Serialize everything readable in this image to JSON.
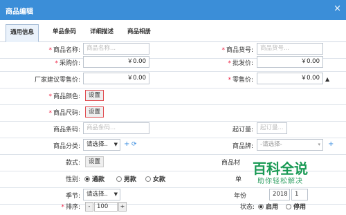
{
  "window": {
    "title": "商品编辑",
    "close_glyph": "×"
  },
  "tabs": [
    {
      "label": "通用信息",
      "active": true
    },
    {
      "label": "单品条码",
      "active": false
    },
    {
      "label": "详细描述",
      "active": false
    },
    {
      "label": "商品相册",
      "active": false
    }
  ],
  "form": {
    "name": {
      "label": "商品名称:",
      "placeholder": "商品名称..."
    },
    "item_no": {
      "label": "商品货号:",
      "placeholder": "商品货号..."
    },
    "purchase_price": {
      "label": "采购价:",
      "value": "￥0.00"
    },
    "wholesale_price": {
      "label": "批发价:",
      "value": "￥0.00"
    },
    "msrp": {
      "label": "厂家建议零售价:",
      "value": "￥0.00"
    },
    "retail_price": {
      "label": "零售价:",
      "value": "￥0.00",
      "toggle": "▲"
    },
    "color": {
      "label": "商品颜色:",
      "button": "设置"
    },
    "size": {
      "label": "商品尺码:",
      "button": "设置"
    },
    "barcode": {
      "label": "商品条码:",
      "placeholder": "商品条码..."
    },
    "min_order": {
      "label": "起订量:",
      "placeholder": "起订量..."
    },
    "category": {
      "label": "商品分类:",
      "select": "请选择..",
      "add": "+",
      "refresh": "⟳"
    },
    "brand": {
      "label": "商品牌:",
      "select": "-请选择-",
      "add": "+"
    },
    "style": {
      "label": "款式:",
      "button": "设置"
    },
    "material": {
      "label": "商品材"
    },
    "gender": {
      "label": "性别:",
      "options": [
        "通款",
        "男款",
        "女款"
      ],
      "selected": 0
    },
    "unit": {
      "label": "单"
    },
    "season": {
      "label": "季节:",
      "select": "请选择.."
    },
    "year": {
      "label": "年份",
      "value": "2018",
      "select": "1"
    },
    "sort": {
      "label": "排序:",
      "minus": "-",
      "value": "100",
      "plus": "+"
    },
    "status": {
      "label": "状态:",
      "options": [
        "启用",
        "停用"
      ],
      "selected": 0
    }
  },
  "watermark": {
    "main": "百科全说",
    "sub": "助你轻松解决"
  },
  "colors": {
    "titlebar": "#3b8ed8",
    "required": "#e24",
    "accent_blue": "#3a8de0",
    "watermark_green": "#1a9a55"
  }
}
